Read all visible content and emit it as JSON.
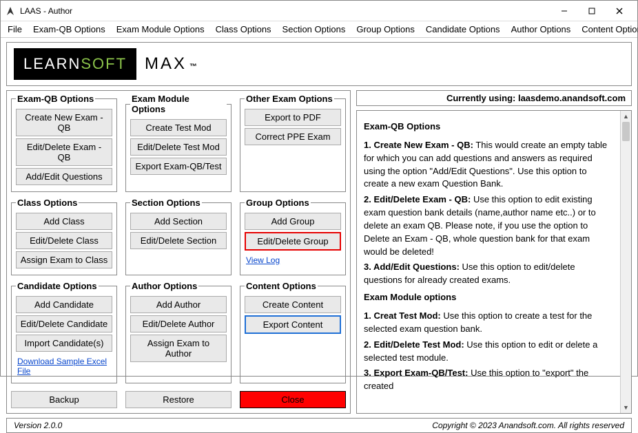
{
  "window": {
    "title": "LAAS - Author"
  },
  "menubar": [
    "File",
    "Exam-QB Options",
    "Exam Module Options",
    "Class Options",
    "Section Options",
    "Group Options",
    "Candidate Options",
    "Author Options",
    "Content Options"
  ],
  "logo": {
    "learn": "LEARN",
    "soft": "SOFT",
    "max": "MAX",
    "tm": "™"
  },
  "groups": {
    "examQB": {
      "title": "Exam-QB Options",
      "buttons": [
        "Create New Exam - QB",
        "Edit/Delete Exam - QB",
        "Add/Edit Questions"
      ]
    },
    "examModule": {
      "title": "Exam Module Options",
      "buttons": [
        "Create Test Mod",
        "Edit/Delete Test Mod",
        "Export Exam-QB/Test"
      ]
    },
    "otherExam": {
      "title": "Other Exam Options",
      "buttons": [
        "Export to PDF",
        "Correct PPE Exam"
      ]
    },
    "classOpt": {
      "title": "Class Options",
      "buttons": [
        "Add Class",
        "Edit/Delete Class",
        "Assign Exam to Class"
      ]
    },
    "sectionOpt": {
      "title": "Section Options",
      "buttons": [
        "Add Section",
        "Edit/Delete Section"
      ]
    },
    "groupOpt": {
      "title": "Group Options",
      "buttons": [
        "Add Group",
        "Edit/Delete Group"
      ],
      "viewLog": "View Log"
    },
    "candidate": {
      "title": "Candidate Options",
      "buttons": [
        "Add Candidate",
        "Edit/Delete Candidate",
        "Import Candidate(s)"
      ],
      "download": "Download Sample Excel File"
    },
    "author": {
      "title": "Author Options",
      "buttons": [
        "Add Author",
        "Edit/Delete Author",
        "Assign Exam to Author"
      ]
    },
    "content": {
      "title": "Content Options",
      "buttons": [
        "Create Content",
        "Export Content"
      ]
    }
  },
  "bottom": {
    "backup": "Backup",
    "restore": "Restore",
    "close": "Close"
  },
  "usingBar": "Currently using: laasdemo.anandsoft.com",
  "help": {
    "h1": "Exam-QB Options",
    "p1lead": "1. Create New Exam - QB:",
    "p1": " This would create an empty table for which you can add questions and answers as required using the option \"Add/Edit Questions\". Use this option to create a new exam Question Bank.",
    "p2lead": "2. Edit/Delete Exam - QB:",
    "p2": " Use this option to edit existing exam question bank details (name,author name etc..) or to delete an exam QB. Please note, if you use the option to Delete an Exam - QB, whole question bank for that exam would be deleted!",
    "p3lead": "3. Add/Edit Questions:",
    "p3": " Use this option to edit/delete questions for already created exams.",
    "h2": "Exam Module options",
    "p4lead": "1. Creat Test Mod:",
    "p4": " Use this option to create a test for the selected exam question bank.",
    "p5lead": "2. Edit/Delete Test Mod:",
    "p5": " Use this option to edit or delete a selected test module.",
    "p6lead": "3. Export Exam-QB/Test:",
    "p6": " Use this option to \"export\" the created"
  },
  "footer": {
    "version": "Version 2.0.0",
    "copyright": "Copyright © 2023 Anandsoft.com. All rights reserved"
  }
}
